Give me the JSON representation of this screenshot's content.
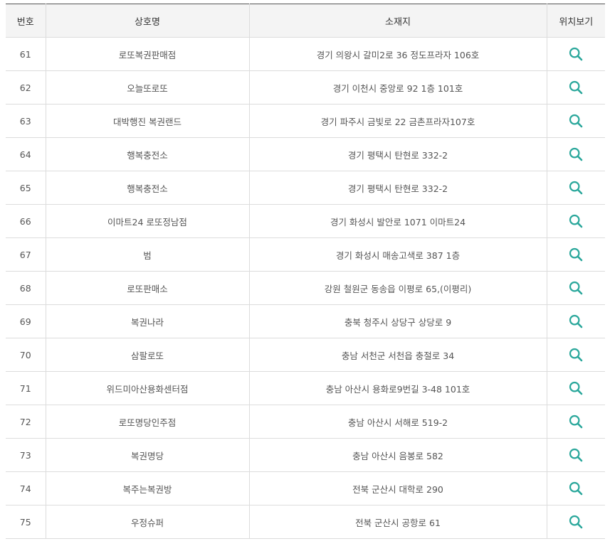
{
  "table": {
    "headers": {
      "no": "번호",
      "name": "상호명",
      "address": "소재지",
      "map": "위치보기"
    },
    "accent_color": "#2aa79b",
    "map_icon": "search-icon",
    "rows": [
      {
        "no": "61",
        "name": "로또복권판매점",
        "address": "경기 의왕시 갈미2로 36 정도프라자 106호"
      },
      {
        "no": "62",
        "name": "오늘또로또",
        "address": "경기 이천시 중앙로 92 1층 101호"
      },
      {
        "no": "63",
        "name": "대박행진 복권랜드",
        "address": "경기 파주시 금빛로 22 금촌프라자107호"
      },
      {
        "no": "64",
        "name": "행복충전소",
        "address": "경기 평택시 탄현로 332-2"
      },
      {
        "no": "65",
        "name": "행복충전소",
        "address": "경기 평택시 탄현로 332-2"
      },
      {
        "no": "66",
        "name": "이마트24 로또정남점",
        "address": "경기 화성시 발안로 1071 이마트24"
      },
      {
        "no": "67",
        "name": "범",
        "address": "경기 화성시 매송고색로 387 1층"
      },
      {
        "no": "68",
        "name": "로또판매소",
        "address": "강원 철원군 동송읍 이평로 65,(이평리)"
      },
      {
        "no": "69",
        "name": "복권나라",
        "address": "충북 청주시 상당구 상당로 9"
      },
      {
        "no": "70",
        "name": "삼팔로또",
        "address": "충남 서천군 서천읍 충절로 34"
      },
      {
        "no": "71",
        "name": "위드미아산용화센터점",
        "address": "충남 아산시 용화로9번길 3-48 101호"
      },
      {
        "no": "72",
        "name": "로또명당인주점",
        "address": "충남 아산시 서해로 519-2"
      },
      {
        "no": "73",
        "name": "복권명당",
        "address": "충남 아산시 음봉로 582"
      },
      {
        "no": "74",
        "name": "복주는복권방",
        "address": "전북 군산시 대학로 290"
      },
      {
        "no": "75",
        "name": "우정슈퍼",
        "address": "전북 군산시 공항로 61"
      }
    ]
  }
}
